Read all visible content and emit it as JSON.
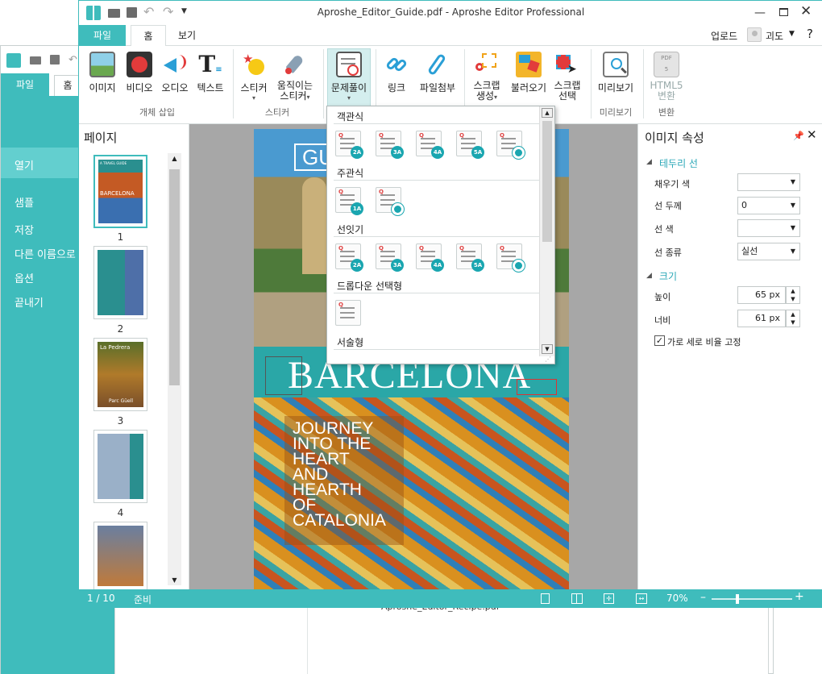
{
  "back_window": {
    "tab_file": "파일",
    "tab_home": "홈",
    "menu": [
      "열기",
      "샘플",
      "저장",
      "다른 이름으로",
      "옵션",
      "끝내기"
    ],
    "document_name": "Aproshe_Editor_Recipe.pdf"
  },
  "window": {
    "title": "Aproshe_Editor_Guide.pdf - Aproshe Editor Professional",
    "upload": "업로드",
    "user": "괴도"
  },
  "tabs": {
    "file": "파일",
    "home": "홈",
    "view": "보기"
  },
  "ribbon": {
    "insert": {
      "image": "이미지",
      "video": "비디오",
      "audio": "오디오",
      "text": "텍스트",
      "group": "개체 삽입"
    },
    "sticker": {
      "sticker": "스티커",
      "moving_l1": "움직이는",
      "moving_l2": "스티커",
      "group": "스티커"
    },
    "quiz": "문제풀이",
    "link": "링크",
    "attach": "파일첨부",
    "scrap_create_l1": "스크랩",
    "scrap_create_l2": "생성",
    "load": "불러오기",
    "scrap_select_l1": "스크랩",
    "scrap_select_l2": "선택",
    "preview": {
      "label": "미리보기",
      "group": "미리보기"
    },
    "convert": {
      "html5_l1": "HTML5",
      "html5_l2": "변환",
      "group": "변환"
    }
  },
  "pages_panel": {
    "title": "페이지",
    "numbers": [
      "1",
      "2",
      "3",
      "4"
    ]
  },
  "document": {
    "badge": "GUIDE",
    "city": "BARCELONA",
    "tagline": [
      "JOURNEY",
      "INTO THE",
      "HEART",
      "AND",
      "HEARTH",
      "OF",
      "CATALONIA"
    ]
  },
  "thumbs": {
    "t1_top": "A TRAVEL GUIDE",
    "t1_title": "BARCELONA",
    "t3_title": "La Pedrera",
    "t3_caption": "Parc Güell"
  },
  "quiz_dropdown": {
    "sections": [
      "객관식",
      "주관식",
      "선잇기",
      "드롭다운 선택형",
      "서술형"
    ],
    "mc_badges": [
      "2A",
      "3A",
      "4A",
      "5A"
    ],
    "sa_badges": [
      "1A"
    ],
    "link_badges": [
      "2A",
      "3A",
      "4A",
      "5A"
    ]
  },
  "properties": {
    "title": "이미지 속성",
    "border_section": "테두리 선",
    "fill_color_label": "채우기 색",
    "line_width_label": "선 두께",
    "line_width_value": "0",
    "line_color_label": "선 색",
    "line_type_label": "선 종류",
    "line_type_value": "실선",
    "size_section": "크기",
    "height_label": "높이",
    "height_value": "65 px",
    "width_label": "너비",
    "width_value": "61 px",
    "lock_ratio_label": "가로 세로 비율 고정",
    "lock_ratio_checked": true
  },
  "status": {
    "page": "1 / 10",
    "state": "준비",
    "zoom": "70%"
  },
  "colors": {
    "accent": "#3fbcbc",
    "accent_light": "#63cfcf",
    "badge": "#1aa6b0"
  }
}
